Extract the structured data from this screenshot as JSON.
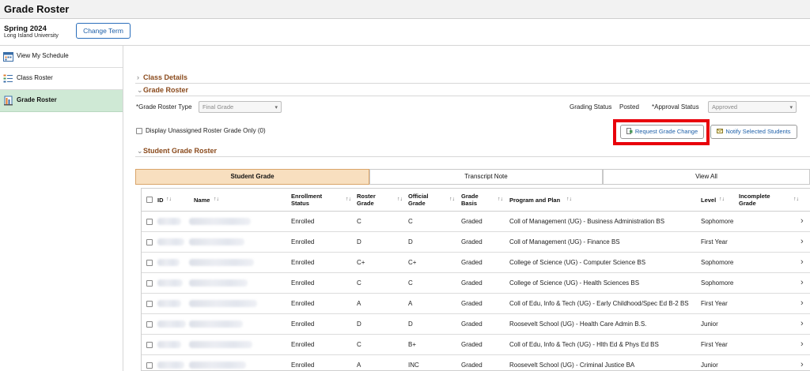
{
  "page": {
    "title": "Grade Roster"
  },
  "term": {
    "name": "Spring 2024",
    "institution": "Long Island University",
    "change_term_label": "Change Term"
  },
  "sidebar": {
    "items": [
      {
        "label": "View My Schedule",
        "icon": "calendar-icon"
      },
      {
        "label": "Class Roster",
        "icon": "list-icon"
      },
      {
        "label": "Grade Roster",
        "icon": "gradebook-icon",
        "active": true
      }
    ]
  },
  "sections": {
    "class_details": "Class Details",
    "grade_roster": "Grade Roster",
    "student_grade_roster": "Student Grade Roster"
  },
  "filters": {
    "roster_type_label": "*Grade Roster Type",
    "roster_type_value": "Final Grade",
    "grading_status_label": "Grading Status",
    "grading_status_value": "Posted",
    "approval_status_label": "*Approval Status",
    "approval_status_value": "Approved",
    "unassigned_label": "Display Unassigned Roster Grade Only (0)"
  },
  "actions": {
    "request_grade_change": "Request Grade Change",
    "notify_selected": "Notify Selected Students"
  },
  "tabs": [
    "Student Grade",
    "Transcript Note",
    "View All"
  ],
  "table": {
    "headers": {
      "id": "ID",
      "name": "Name",
      "enrollment_status_1": "Enrollment",
      "enrollment_status_2": "Status",
      "roster_grade_1": "Roster",
      "roster_grade_2": "Grade",
      "official_grade_1": "Official",
      "official_grade_2": "Grade",
      "grade_basis_1": "Grade",
      "grade_basis_2": "Basis",
      "program": "Program and Plan",
      "level": "Level",
      "incomplete_1": "Incomplete",
      "incomplete_2": "Grade",
      "sort_glyph": "↑↓"
    },
    "rows": [
      {
        "status": "Enrolled",
        "roster": "C",
        "official": "C",
        "basis": "Graded",
        "program": "Coll of Management (UG) - Business Administration BS",
        "level": "Sophomore"
      },
      {
        "status": "Enrolled",
        "roster": "D",
        "official": "D",
        "basis": "Graded",
        "program": "Coll of Management (UG) - Finance BS",
        "level": "First Year"
      },
      {
        "status": "Enrolled",
        "roster": "C+",
        "official": "C+",
        "basis": "Graded",
        "program": "College of Science (UG) - Computer Science BS",
        "level": "Sophomore"
      },
      {
        "status": "Enrolled",
        "roster": "C",
        "official": "C",
        "basis": "Graded",
        "program": "College of Science (UG) - Health Sciences BS",
        "level": "Sophomore"
      },
      {
        "status": "Enrolled",
        "roster": "A",
        "official": "A",
        "basis": "Graded",
        "program": "Coll of Edu, Info & Tech (UG) - Early Childhood/Spec Ed B-2 BS",
        "level": "First Year"
      },
      {
        "status": "Enrolled",
        "roster": "D",
        "official": "D",
        "basis": "Graded",
        "program": "Roosevelt  School (UG) - Health Care Admin B.S.",
        "level": "Junior"
      },
      {
        "status": "Enrolled",
        "roster": "C",
        "official": "B+",
        "basis": "Graded",
        "program": "Coll of Edu, Info & Tech (UG) - Hlth Ed & Phys Ed BS",
        "level": "First Year"
      },
      {
        "status": "Enrolled",
        "roster": "A",
        "official": "INC",
        "basis": "Graded",
        "program": "Roosevelt  School (UG) - Criminal Justice BA",
        "level": "Junior"
      }
    ]
  },
  "colors": {
    "section_header": "#8a4a1c",
    "active_nav": "#cfe9d5",
    "active_tab": "#f8dfbf",
    "highlight": "#e8000b",
    "link_blue": "#1d5fa8"
  }
}
